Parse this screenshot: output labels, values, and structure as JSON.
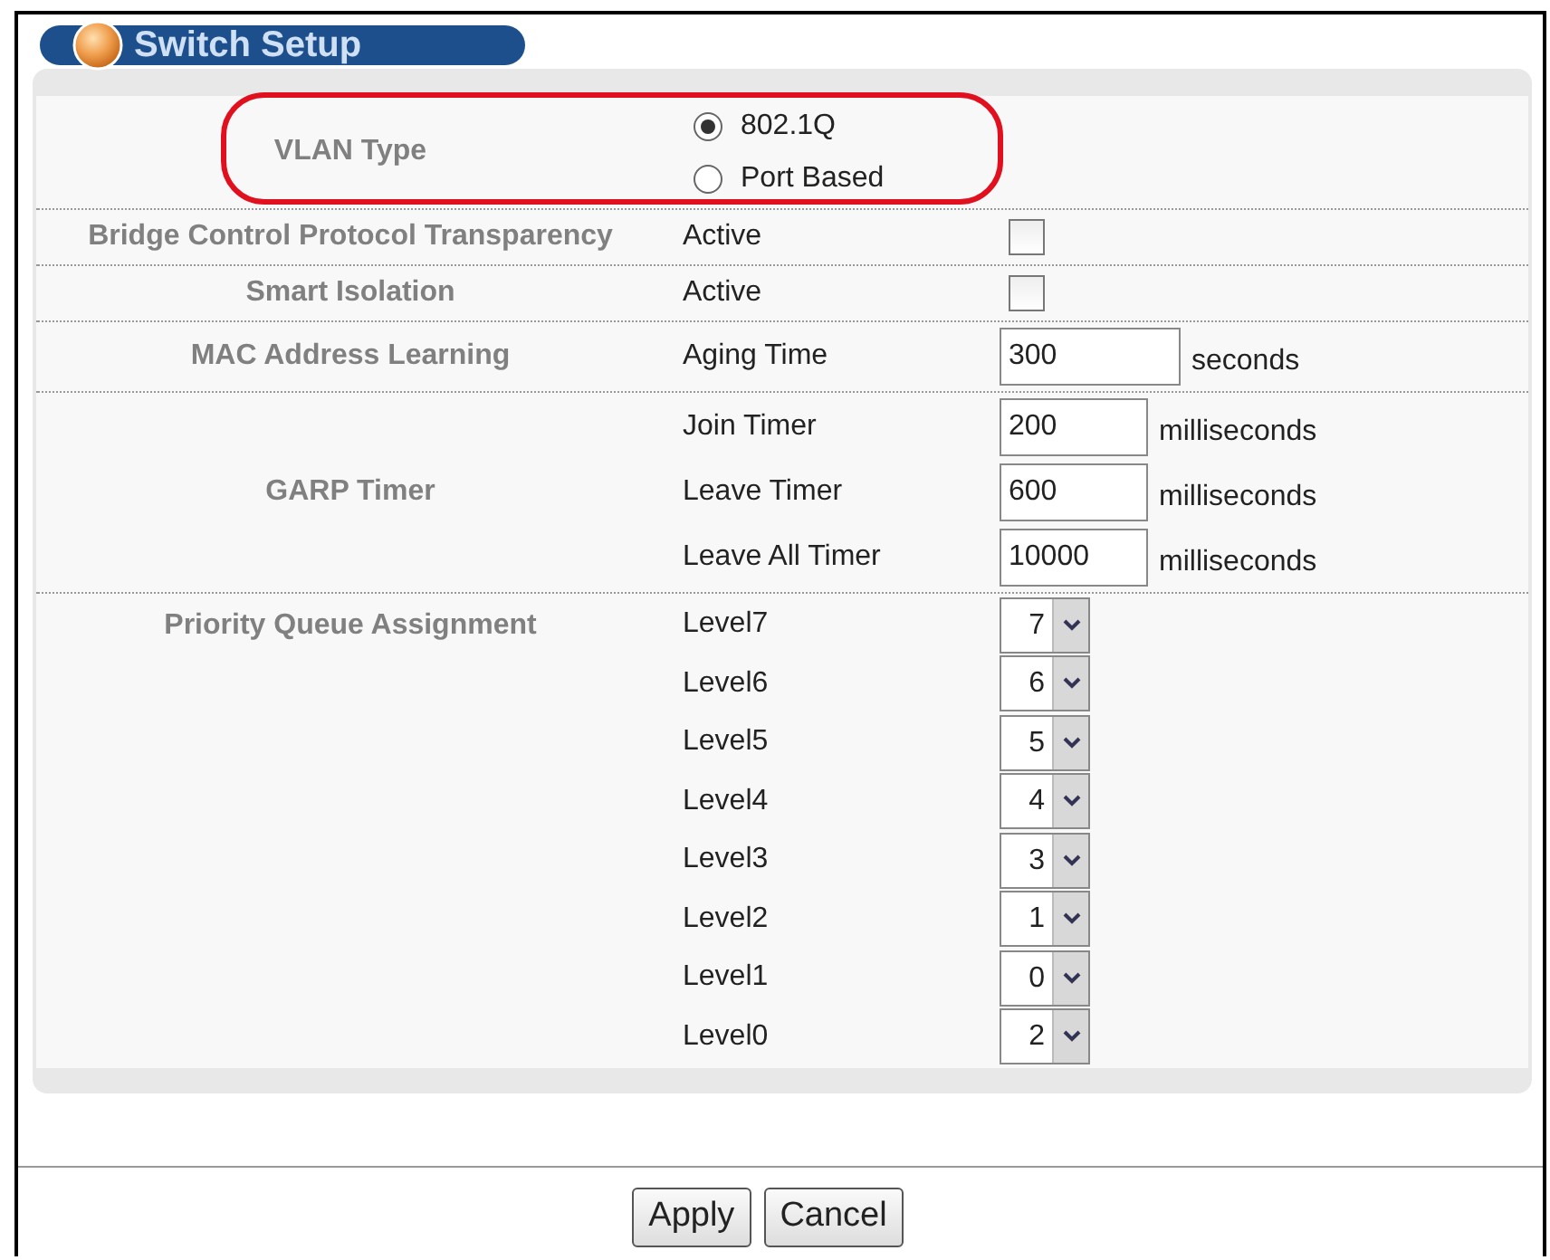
{
  "title": "Switch Setup",
  "sections": [
    {
      "label": "VLAN Type",
      "highlighted": true,
      "rows": [
        {
          "kind": "radio",
          "text": "802.1Q",
          "selected": true
        },
        {
          "kind": "radio",
          "text": "Port Based",
          "selected": false
        }
      ]
    },
    {
      "label": "Bridge Control Protocol Transparency",
      "rows": [
        {
          "kind": "checkbox",
          "text": "Active",
          "checked": false
        }
      ]
    },
    {
      "label": "Smart Isolation",
      "rows": [
        {
          "kind": "checkbox",
          "text": "Active",
          "checked": false
        }
      ]
    },
    {
      "label": "MAC Address Learning",
      "rows": [
        {
          "kind": "input",
          "text": "Aging Time",
          "value": "300",
          "unit": "seconds"
        }
      ]
    },
    {
      "label": "GARP Timer",
      "rows": [
        {
          "kind": "input",
          "text": "Join Timer",
          "value": "200",
          "unit": "milliseconds"
        },
        {
          "kind": "input",
          "text": "Leave Timer",
          "value": "600",
          "unit": "milliseconds"
        },
        {
          "kind": "input",
          "text": "Leave All Timer",
          "value": "10000",
          "unit": "milliseconds"
        }
      ]
    },
    {
      "label": "Priority Queue Assignment",
      "rows": [
        {
          "kind": "select",
          "text": "Level7",
          "value": "7"
        },
        {
          "kind": "select",
          "text": "Level6",
          "value": "6"
        },
        {
          "kind": "select",
          "text": "Level5",
          "value": "5"
        },
        {
          "kind": "select",
          "text": "Level4",
          "value": "4"
        },
        {
          "kind": "select",
          "text": "Level3",
          "value": "3"
        },
        {
          "kind": "select",
          "text": "Level2",
          "value": "1"
        },
        {
          "kind": "select",
          "text": "Level1",
          "value": "0"
        },
        {
          "kind": "select",
          "text": "Level0",
          "value": "2"
        }
      ]
    }
  ],
  "buttons": [
    "Apply",
    "Cancel"
  ]
}
